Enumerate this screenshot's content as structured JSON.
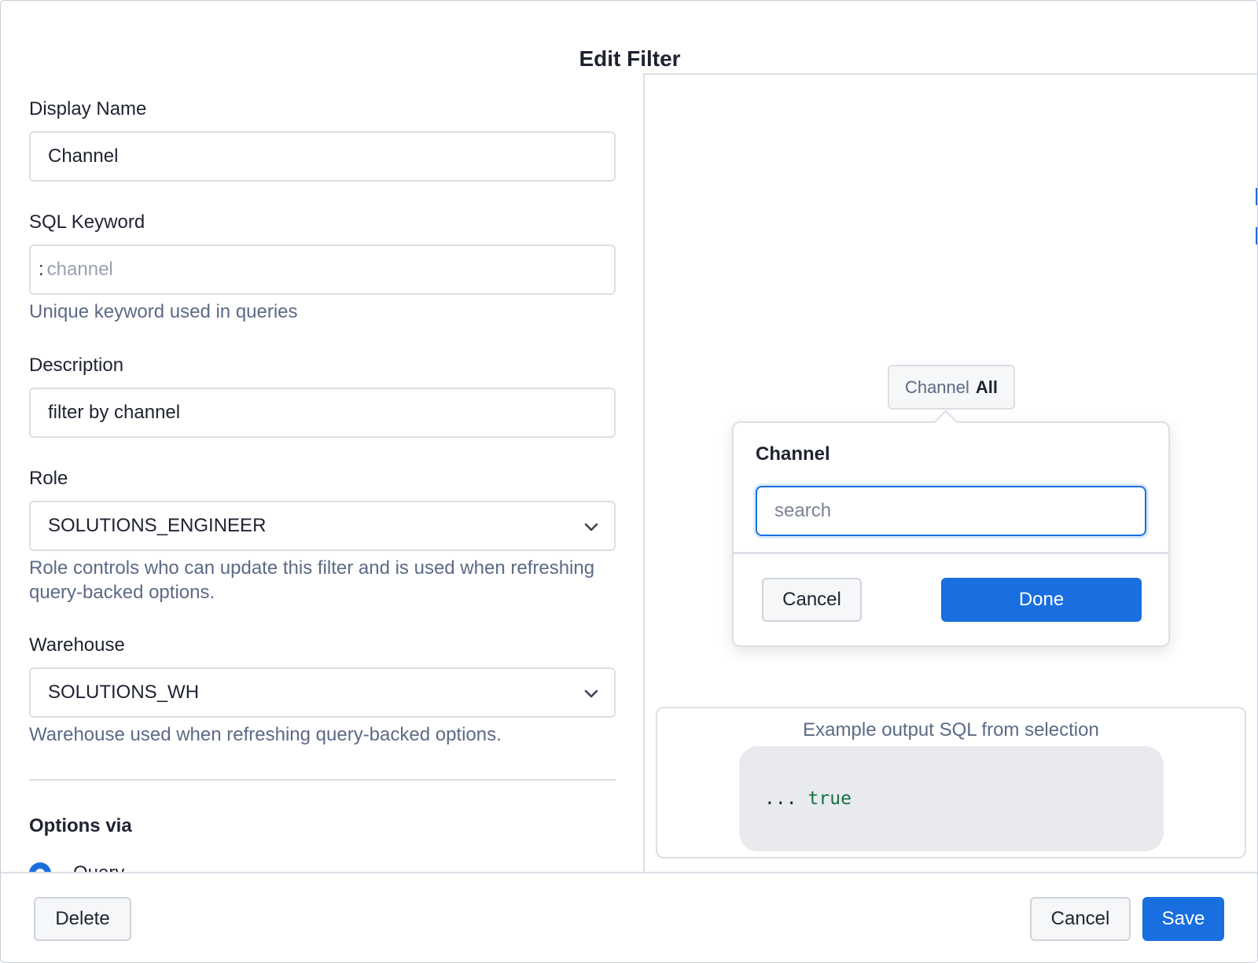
{
  "dialog": {
    "title": "Edit Filter"
  },
  "form": {
    "display_name": {
      "label": "Display Name",
      "value": "Channel"
    },
    "sql_keyword": {
      "label": "SQL Keyword",
      "prefix": ":",
      "placeholder": "channel",
      "help": "Unique keyword used in queries"
    },
    "description": {
      "label": "Description",
      "value": "filter by channel"
    },
    "role": {
      "label": "Role",
      "value": "SOLUTIONS_ENGINEER",
      "help": "Role controls who can update this filter and is used when refreshing query-backed options."
    },
    "warehouse": {
      "label": "Warehouse",
      "value": "SOLUTIONS_WH",
      "help": "Warehouse used when refreshing query-backed options."
    },
    "options_via": {
      "title": "Options via",
      "selected_option": "Query"
    }
  },
  "preview": {
    "chip": {
      "key": "Channel",
      "value": "All"
    },
    "popover": {
      "title": "Channel",
      "search_placeholder": "search",
      "cancel_label": "Cancel",
      "done_label": "Done"
    },
    "sql": {
      "title": "Example output SQL from selection",
      "prefix": "...",
      "keyword": "true"
    }
  },
  "footer": {
    "delete_label": "Delete",
    "cancel_label": "Cancel",
    "save_label": "Save"
  },
  "colors": {
    "accent": "#1a6fe0",
    "help_text": "#5b6a86",
    "border": "#dcdfe6",
    "code_keyword": "#137046"
  },
  "icons": {
    "select_chevron": "chevron-down-icon",
    "radio": "radio-selected-icon"
  }
}
